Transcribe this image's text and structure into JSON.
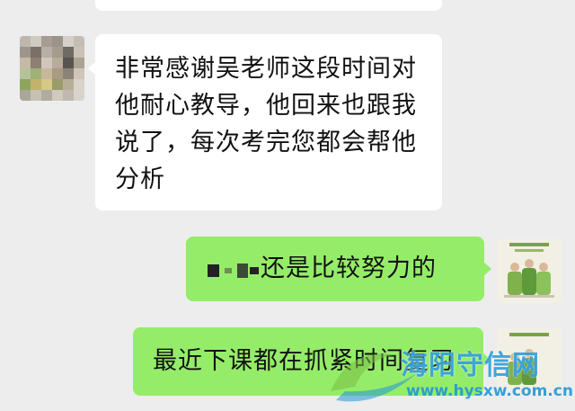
{
  "chat": {
    "messages": [
      {
        "sender": "other",
        "text": "非常感谢吴老师这段时间对他耐心教导，他回来也跟我说了，每次考完您都会帮他分析"
      },
      {
        "sender": "self",
        "redacted_prefix": "█ ▪ ▬",
        "text": "还是比较努力的"
      },
      {
        "sender": "self",
        "text": "最近下课都在抓紧时间复习"
      }
    ]
  },
  "watermark": {
    "title": "海阳守信网",
    "url": "www.hysxw.com.cn"
  },
  "colors": {
    "background": "#ededed",
    "incoming_bubble": "#ffffff",
    "outgoing_bubble": "#95ec69",
    "watermark": "#2096d7"
  },
  "icons": {
    "contact_avatar": "pixelated-photo-avatar",
    "self_avatar": "illustrated-people-avatar",
    "watermark_logo": "swoosh-logo-icon"
  }
}
